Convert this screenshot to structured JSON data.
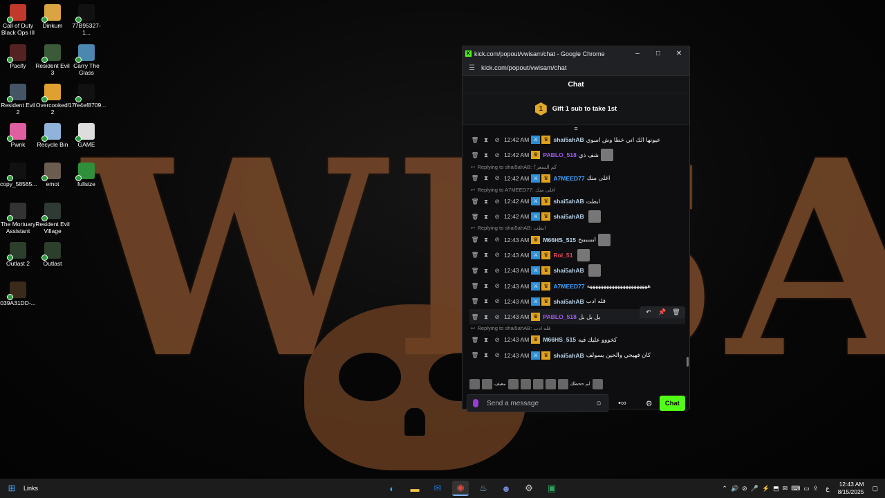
{
  "window": {
    "title": "kick.com/popout/vwisam/chat - Google Chrome",
    "url": "kick.com/popout/vwisam/chat",
    "min": "–",
    "max": "□",
    "close": "✕"
  },
  "wallpaper": {
    "logo_text": "WISAM"
  },
  "desktop_icons": [
    {
      "label": "Call of Duty Black Ops III",
      "color": "#c0392b"
    },
    {
      "label": "Dinkum",
      "color": "#d9a441"
    },
    {
      "label": "77B95327-1...",
      "color": "#111111"
    },
    {
      "label": "Pacify",
      "color": "#552222"
    },
    {
      "label": "Resident Evil 3",
      "color": "#3a5a3a"
    },
    {
      "label": "Carry The Glass",
      "color": "#4c87b0"
    },
    {
      "label": "Resident Evil 2",
      "color": "#445566"
    },
    {
      "label": "Overcooked! 2",
      "color": "#e0a030"
    },
    {
      "label": "17fe4ef8709...",
      "color": "#111111"
    },
    {
      "label": "Pwnk",
      "color": "#e05fa0"
    },
    {
      "label": "Recycle Bin",
      "color": "#8fb3d9"
    },
    {
      "label": "GAME",
      "color": "#dddddd"
    },
    {
      "label": "copy_58565...",
      "color": "#111111"
    },
    {
      "label": "emot",
      "color": "#6a5d4f"
    },
    {
      "label": "fullsize",
      "color": "#2f8f3a"
    },
    {
      "label": "The Mortuary Assistant",
      "color": "#333333"
    },
    {
      "label": "Resident Evil Village",
      "color": "#2e3a33"
    },
    {
      "label": "Outlast 2",
      "color": "#2c3e2c"
    },
    {
      "label": "Outlast",
      "color": "#2c3e2c"
    },
    {
      "label": "039A31DD-...",
      "color": "#3a2a1a"
    }
  ],
  "chat": {
    "header": "Chat",
    "gift_badge": "1",
    "gift_text": "Gift 1 sub to take 1st",
    "pin_icon": "≡",
    "messages": [
      {
        "type": "msg",
        "time": "12:42 AM",
        "user": "shai5ahAB",
        "color": "#b9d3e8",
        "b1": true,
        "text": "عيونها الك اني خطا وش اسوي",
        "emote": false
      },
      {
        "type": "msg",
        "time": "12:42 AM",
        "user": "PABLO_518",
        "color": "#a05cf0",
        "b1": false,
        "text": "شف ذي",
        "emote": true
      },
      {
        "type": "reply",
        "text": "Replying to shai5ahAB: كم السعر؟"
      },
      {
        "type": "msg",
        "time": "12:42 AM",
        "user": "A7MEED77",
        "color": "#3fa2ff",
        "b1": true,
        "text": "اغلى منك",
        "emote": false
      },
      {
        "type": "reply",
        "text": "Replying to A7MEED77: اغلى منك"
      },
      {
        "type": "msg",
        "time": "12:42 AM",
        "user": "shai5ahAB",
        "color": "#b9d3e8",
        "b1": true,
        "text": "ابطت",
        "emote": false
      },
      {
        "type": "msg",
        "time": "12:42 AM",
        "user": "shai5ahAB",
        "color": "#b9d3e8",
        "b1": true,
        "text": "",
        "emote": true
      },
      {
        "type": "reply",
        "text": "Replying to shai5ahAB: ابطت"
      },
      {
        "type": "msg",
        "time": "12:43 AM",
        "user": "M66HS_515",
        "color": "#b9d3e8",
        "b1": false,
        "text": "ابببببببح",
        "emote": true
      },
      {
        "type": "msg",
        "time": "12:43 AM",
        "user": "Rol_51",
        "color": "#e84a5f",
        "b1": true,
        "text": "",
        "emote": true
      },
      {
        "type": "msg",
        "time": "12:43 AM",
        "user": "shai5ahAB",
        "color": "#b9d3e8",
        "b1": true,
        "text": "",
        "emote": true
      },
      {
        "type": "msg",
        "time": "12:43 AM",
        "user": "A7MEED77",
        "color": "#3fa2ff",
        "b1": true,
        "text": "ههههههههههههههههههههههه",
        "emote": false
      },
      {
        "type": "msg",
        "time": "12:43 AM",
        "user": "shai5ahAB",
        "color": "#b9d3e8",
        "b1": true,
        "text": "قله ادب",
        "emote": false
      },
      {
        "type": "msg",
        "time": "12:43 AM",
        "user": "PABLO_518",
        "color": "#a05cf0",
        "b1": false,
        "text": "بل بل بل",
        "emote": false,
        "hover": true
      },
      {
        "type": "reply",
        "text": "Replying to shai5ahAB: قله ادب"
      },
      {
        "type": "msg",
        "time": "12:43 AM",
        "user": "M66HS_515",
        "color": "#b9d3e8",
        "b1": false,
        "text": "كخووو عليك فيه",
        "emote": false
      },
      {
        "type": "msg",
        "time": "12:43 AM",
        "user": "shai5ahAB",
        "color": "#b9d3e8",
        "b1": true,
        "text": "كان فهيجي والحين يسولف",
        "emote": false
      }
    ],
    "message_actions": {
      "reply": "↶",
      "pin": "📌",
      "delete": "🗑"
    },
    "emote_row_text": [
      "معبف",
      "لم ححطك"
    ],
    "input_placeholder": "Send a message",
    "points_icon": "•∞",
    "settings_icon": "⚙",
    "send_label": "Chat"
  },
  "taskbar": {
    "start_icon": "⊞",
    "links_label": "Links",
    "time": "12:43 AM",
    "date": "8/15/2025",
    "lang": "ع",
    "apps": [
      {
        "name": "edge",
        "glyph": "◐",
        "color": "#2fa3e8"
      },
      {
        "name": "file-explorer",
        "glyph": "▬",
        "color": "#f2c14e"
      },
      {
        "name": "outlook",
        "glyph": "✉",
        "color": "#1f74d6"
      },
      {
        "name": "chrome",
        "glyph": "◉",
        "color": "#e8453c",
        "active": true
      },
      {
        "name": "steam",
        "glyph": "♨",
        "color": "#8fb8de"
      },
      {
        "name": "discord",
        "glyph": "☻",
        "color": "#7289da"
      },
      {
        "name": "cheat-tool",
        "glyph": "⚙",
        "color": "#cccccc"
      },
      {
        "name": "excel-like",
        "glyph": "▣",
        "color": "#30a060"
      }
    ],
    "tray": [
      "⌃",
      "🔊",
      "⊘",
      "🎤",
      "⚡",
      "⬒",
      "✉",
      "⌨",
      "▭",
      "⇪"
    ]
  }
}
